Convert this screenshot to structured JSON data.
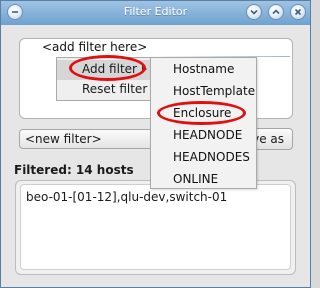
{
  "window": {
    "title": "Filter Editor"
  },
  "filter": {
    "placeholder_text": "<add filter here>"
  },
  "context_menu": {
    "items": [
      {
        "label": "Add filter"
      },
      {
        "label": "Reset filter"
      }
    ]
  },
  "submenu": {
    "items": [
      {
        "label": "Hostname"
      },
      {
        "label": "HostTemplate"
      },
      {
        "label": "Enclosure"
      },
      {
        "label": "HEADNODE"
      },
      {
        "label": "HEADNODES"
      },
      {
        "label": "ONLINE"
      }
    ]
  },
  "controls": {
    "new_filter_label": "<new filter>",
    "save_as_label": "ve as"
  },
  "results": {
    "summary": "Filtered: 14 hosts",
    "hosts_text": "beo-01-[01-12],qlu-dev,switch-01"
  },
  "colors": {
    "highlight_oval": "#e01010",
    "titlebar": "#7aa9d4"
  }
}
